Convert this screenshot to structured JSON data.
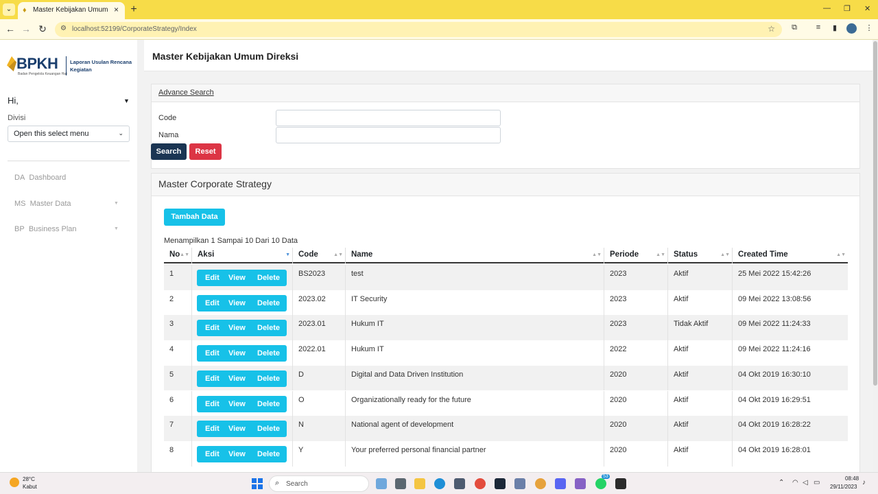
{
  "browser": {
    "tab_title": "Master Kebijakan Umum Direksi",
    "url": "localhost:52199/CorporateStrategy/Index",
    "accent": "#f7dc48"
  },
  "sidebar": {
    "logo_text": "BPKH",
    "logo_sub": "Badan Pengelola Keuangan Haji",
    "logo_caption": "Laporan Usulan Rencana Kegiatan",
    "greeting": "Hi,",
    "divisi_label": "Divisi",
    "divisi_select": "Open this select menu",
    "items": [
      {
        "abbr": "DA",
        "label": "Dashboard",
        "has_submenu": false
      },
      {
        "abbr": "MS",
        "label": "Master Data",
        "has_submenu": true
      },
      {
        "abbr": "BP",
        "label": "Business Plan",
        "has_submenu": true
      }
    ]
  },
  "page": {
    "title": "Master Kebijakan Umum Direksi"
  },
  "search": {
    "advance_link": "Advance Search",
    "code_label": "Code",
    "code_value": "",
    "nama_label": "Nama",
    "nama_value": "",
    "search_button": "Search",
    "reset_button": "Reset"
  },
  "listing": {
    "title": "Master Corporate Strategy",
    "add_button": "Tambah Data",
    "info": "Menampilkan 1 Sampai 10 Dari 10 Data",
    "columns": [
      "No",
      "Aksi",
      "Code",
      "Name",
      "Periode",
      "Status",
      "Created Time"
    ],
    "actions": {
      "edit": "Edit",
      "view": "View",
      "delete": "Delete"
    },
    "rows": [
      {
        "no": "1",
        "code": "BS2023",
        "name": "test",
        "periode": "2023",
        "status": "Aktif",
        "created": "25 Mei 2022 15:42:26"
      },
      {
        "no": "2",
        "code": "2023.02",
        "name": "IT Security",
        "periode": "2023",
        "status": "Aktif",
        "created": "09 Mei 2022 13:08:56"
      },
      {
        "no": "3",
        "code": "2023.01",
        "name": "Hukum IT",
        "periode": "2023",
        "status": "Tidak Aktif",
        "created": "09 Mei 2022 11:24:33"
      },
      {
        "no": "4",
        "code": "2022.01",
        "name": "Hukum IT",
        "periode": "2022",
        "status": "Aktif",
        "created": "09 Mei 2022 11:24:16"
      },
      {
        "no": "5",
        "code": "D",
        "name": "Digital and Data Driven Institution",
        "periode": "2020",
        "status": "Aktif",
        "created": "04 Okt 2019 16:30:10"
      },
      {
        "no": "6",
        "code": "O",
        "name": "Organizationally ready for the future",
        "periode": "2020",
        "status": "Aktif",
        "created": "04 Okt 2019 16:29:51"
      },
      {
        "no": "7",
        "code": "N",
        "name": "National agent of development",
        "periode": "2020",
        "status": "Aktif",
        "created": "04 Okt 2019 16:28:22"
      },
      {
        "no": "8",
        "code": "Y",
        "name": "Your preferred personal financial partner",
        "periode": "2020",
        "status": "Aktif",
        "created": "04 Okt 2019 16:28:01"
      }
    ]
  },
  "taskbar": {
    "weather_temp": "28°C",
    "weather_cond": "Kabut",
    "search_placeholder": "Search",
    "time": "08:48",
    "date": "29/11/2023",
    "badge_count": "53"
  }
}
